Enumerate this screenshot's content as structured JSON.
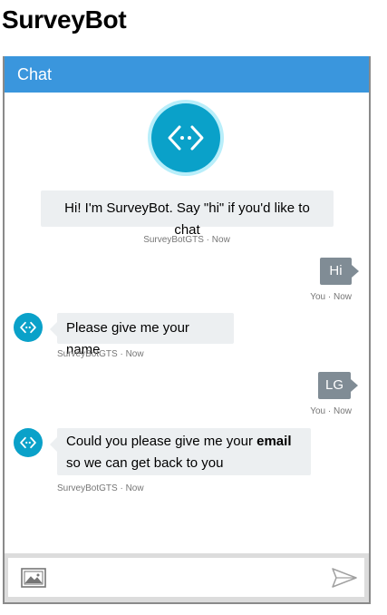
{
  "page": {
    "title": "SurveyBot"
  },
  "chat": {
    "header": "Chat",
    "input_placeholder": "",
    "messages": [
      {
        "from": "bot",
        "text": "Hi! I'm SurveyBot. Say \"hi\" if you'd like to chat",
        "meta": "SurveyBotGTS · Now"
      },
      {
        "from": "user",
        "text": "Hi",
        "meta": "You · Now"
      },
      {
        "from": "bot",
        "text": "Please give me your name",
        "meta": "SurveyBotGTS · Now"
      },
      {
        "from": "user",
        "text": "LG",
        "meta": "You · Now"
      },
      {
        "from": "bot",
        "text_parts": {
          "before": "Could you please give me your ",
          "bold": "email",
          "after": "so we can get back to you"
        },
        "meta": "SurveyBotGTS · Now"
      }
    ]
  },
  "icons": {
    "bot_avatar": "bot-code-icon",
    "attach": "image-upload-icon",
    "send": "send-icon"
  },
  "colors": {
    "header": "#3a96dd",
    "bot_avatar": "#0aa1c9",
    "user_bubble": "#808c95",
    "bot_bubble": "#eceff1"
  }
}
